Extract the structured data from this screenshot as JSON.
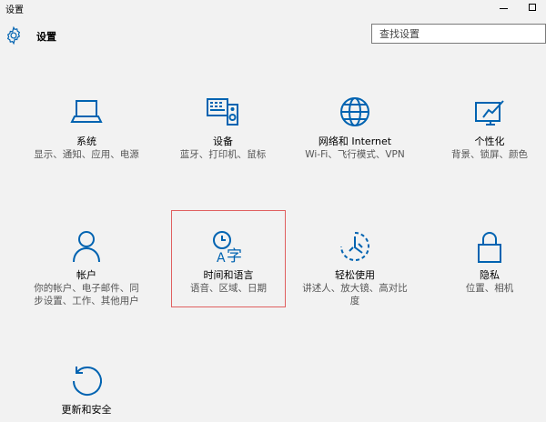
{
  "window": {
    "title": "设置"
  },
  "header": {
    "app_title": "设置",
    "search_placeholder": "查找设置"
  },
  "tiles": [
    {
      "name": "system",
      "icon": "laptop-icon",
      "label": "系统",
      "desc": "显示、通知、应用、电源"
    },
    {
      "name": "devices",
      "icon": "devices-icon",
      "label": "设备",
      "desc": "蓝牙、打印机、鼠标"
    },
    {
      "name": "network",
      "icon": "globe-icon",
      "label": "网络和 Internet",
      "desc": "Wi-Fi、飞行模式、VPN"
    },
    {
      "name": "personalization",
      "icon": "personalization-icon",
      "label": "个性化",
      "desc": "背景、锁屏、颜色"
    },
    {
      "name": "accounts",
      "icon": "person-icon",
      "label": "帐户",
      "desc": "你的帐户、电子邮件、同步设置、工作、其他用户"
    },
    {
      "name": "time-language",
      "icon": "time-language-icon",
      "label": "时间和语言",
      "desc": "语音、区域、日期"
    },
    {
      "name": "ease-of-access",
      "icon": "ease-of-access-icon",
      "label": "轻松使用",
      "desc": "讲述人、放大镜、高对比度"
    },
    {
      "name": "privacy",
      "icon": "lock-icon",
      "label": "隐私",
      "desc": "位置、相机"
    },
    {
      "name": "update-security",
      "icon": "update-icon",
      "label": "更新和安全",
      "desc": ""
    }
  ],
  "colors": {
    "accent": "#0063b1",
    "selection_border": "#e06060",
    "background": "#f2f2f2"
  }
}
